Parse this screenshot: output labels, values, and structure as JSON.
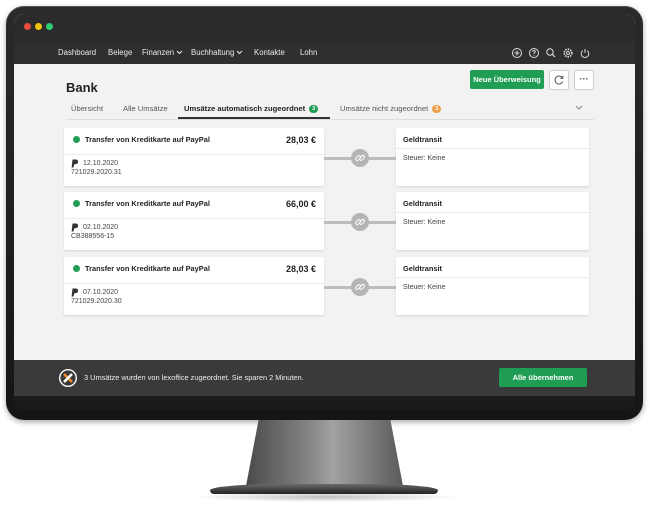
{
  "window": {
    "dots": [
      "#e74c3c",
      "#f1c40f",
      "#2ecc71"
    ]
  },
  "nav": {
    "items": [
      "Dashboard",
      "Belege",
      "Finanzen",
      "Buchhaltung",
      "Kontakte",
      "Lohn"
    ],
    "icons": [
      "plus-circle-icon",
      "help-icon",
      "search-icon",
      "settings-icon",
      "power-icon"
    ]
  },
  "page": {
    "title": "Bank",
    "new_transfer_label": "Neue Überweisung",
    "more_label": "···"
  },
  "tabs": [
    {
      "label": "Übersicht"
    },
    {
      "label": "Alle Umsätze"
    },
    {
      "label": "Umsätze automatisch zugeordnet",
      "badge": "3",
      "badge_color": "#1f9d55"
    },
    {
      "label": "Umsätze nicht zugeordnet",
      "badge": "3",
      "badge_color": "#f0a04b"
    }
  ],
  "transactions": [
    {
      "title": "Transfer von Kreditkarte auf PayPal",
      "amount": "28,03 €",
      "date": "12.10.2020",
      "ref": "721029.2020.31",
      "account": "Geldtransit",
      "tax": "Steuer: Keine"
    },
    {
      "title": "Transfer von Kreditkarte auf PayPal",
      "amount": "66,00 €",
      "date": "02.10.2020",
      "ref": "CB388556-15",
      "account": "Geldtransit",
      "tax": "Steuer: Keine"
    },
    {
      "title": "Transfer von Kreditkarte auf PayPal",
      "amount": "28,03 €",
      "date": "07.10.2020",
      "ref": "721029.2020.30",
      "account": "Geldtransit",
      "tax": "Steuer: Keine"
    }
  ],
  "footer": {
    "message": "3 Umsätze wurden von lexoffice zugeordnet. Sie sparen 2 Minuten.",
    "accept_label": "Alle übernehmen"
  },
  "colors": {
    "accent": "#1f9d55",
    "warning": "#f0a04b",
    "nav_bg": "#2f2f2f"
  }
}
